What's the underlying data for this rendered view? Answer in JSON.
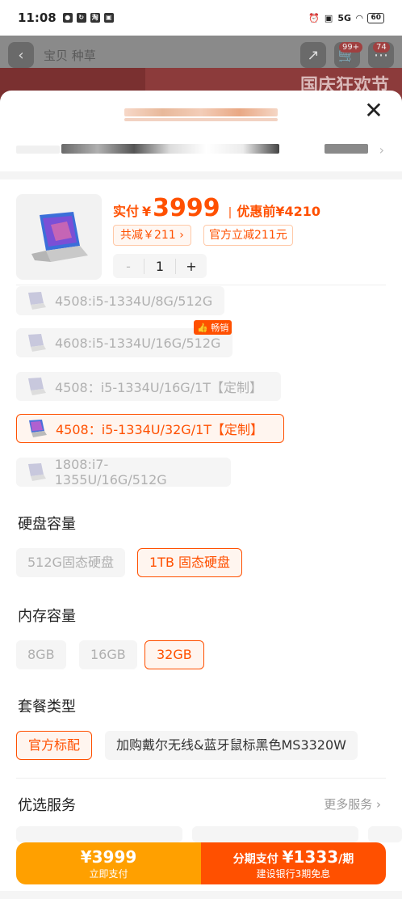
{
  "status_bar": {
    "time": "11:08",
    "battery": "60",
    "signal": "5G"
  },
  "behind": {
    "tabs": "宝贝  种草",
    "banner_text": "国庆狂欢节",
    "cart_badge": "99+",
    "msg_badge": "74"
  },
  "product": {
    "paid_label": "实付",
    "currency": "¥",
    "price": "3999",
    "pre_discount": "优惠前¥4210",
    "discount_chip": "共减￥211",
    "official_chip": "官方立减211元",
    "quantity": "1",
    "minus": "-",
    "plus": "+"
  },
  "options": [
    {
      "label": "4508:i5-1334U/8G/512G"
    },
    {
      "label": "4608:i5-1334U/16G/512G",
      "badge": "👍 畅销"
    },
    {
      "label": "4508：i5-1334U/16G/1T【定制】"
    },
    {
      "label": "4508：i5-1334U/32G/1T【定制】",
      "selected": true
    },
    {
      "label": "1808:i7-1355U/16G/512G"
    }
  ],
  "storage": {
    "title": "硬盘容量",
    "items": [
      "512G固态硬盘",
      "1TB 固态硬盘"
    ]
  },
  "memory": {
    "title": "内存容量",
    "items": [
      "8GB",
      "16GB",
      "32GB"
    ]
  },
  "package": {
    "title": "套餐类型",
    "items": [
      "官方标配",
      "加购戴尔无线&蓝牙鼠标黑色MS3320W"
    ]
  },
  "services": {
    "title": "优选服务",
    "more": "更多服务"
  },
  "pay": {
    "now_amount": "¥3999",
    "now_label": "立即支付",
    "install_prefix": "分期支付",
    "install_amount": "¥1333",
    "install_suffix": "/期",
    "install_sub": "建设银行3期免息"
  },
  "colors": {
    "accent": "#ff5000",
    "pay_now": "#ffa000"
  }
}
